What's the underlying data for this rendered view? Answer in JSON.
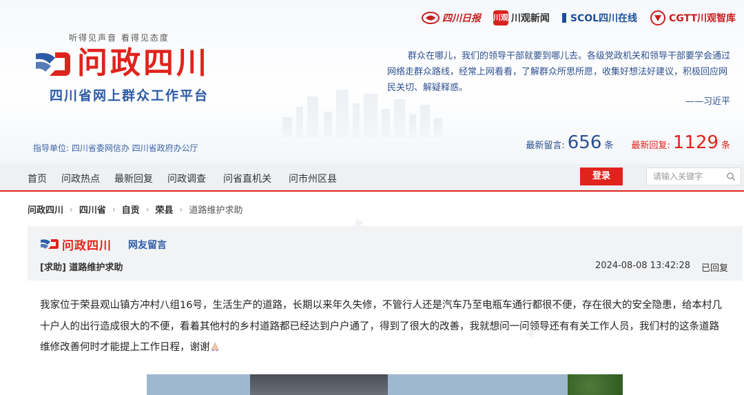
{
  "header": {
    "tagline": "听得见声音  看得见态度",
    "logo_title": "问政四川",
    "logo_subtitle": "四川省网上群众工作平台",
    "guide_units": "指导单位: 四川省委网信办 四川省政府办公厅",
    "partners": [
      {
        "name": "四川日报",
        "icon": "sichuan-daily-logo-icon"
      },
      {
        "name": "川观新闻",
        "badge": "川观",
        "icon": "chuanguan-news-logo-icon"
      },
      {
        "name": "SCOL四川在线",
        "icon": "scol-logo-icon"
      },
      {
        "name": "CGTT川观智库",
        "icon": "cgtt-logo-icon"
      }
    ],
    "quote": "群众在哪儿，我们的领导干部就要到哪儿去。各级党政机关和领导干部要学会通过网络走群众路线，经常上网看看，了解群众所思所愿，收集好想法好建议，积极回应网民关切、解疑释惑。",
    "quote_author": "——习近平",
    "stats": {
      "messages_label": "最新留言:",
      "messages_count": "656",
      "messages_unit": "条",
      "replies_label": "最新回复:",
      "replies_count": "1129",
      "replies_unit": "条"
    }
  },
  "nav": {
    "items": [
      "首页",
      "问政热点",
      "最新回复",
      "问政调查",
      "问省直机关",
      "问市州区县"
    ],
    "login": "登录",
    "search_placeholder": "请输入关键字"
  },
  "breadcrumb": [
    "问政四川",
    "四川省",
    "自贡",
    "荣县",
    "道路维护求助"
  ],
  "post": {
    "brand": "问政四川",
    "section": "网友留言",
    "title": "[求助] 道路维护求助",
    "date": "2024-08-08 13:42:28",
    "status": "已回复",
    "body": "我家位于荣县观山镇方冲村八组16号，生活生产的道路，长期以来年久失修，不管行人还是汽车乃至电瓶车通行都很不便，存在很大的安全隐患，给本村几十户人的出行造成很大的不便，看着其他村的乡村道路都已经达到户户通了，得到了很大的改善，我就想问一问领导还有有关工作人员，我们村的这条道路维修改善何时才能提上工作日程，谢谢"
  },
  "colors": {
    "brand_red": "#e0231c",
    "brand_blue": "#2d5aa6",
    "panel_bg": "#f2f3f5"
  }
}
